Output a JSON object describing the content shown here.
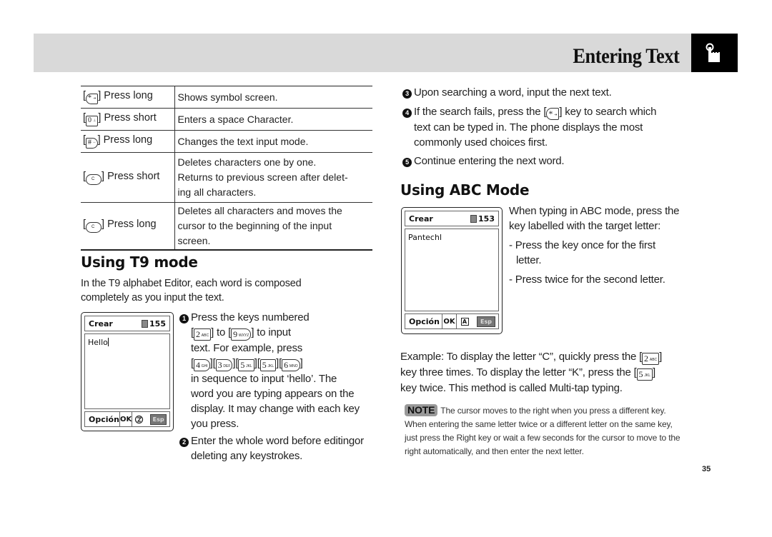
{
  "header": {
    "title": "Entering Text",
    "icon": "hand-pointer-icon"
  },
  "key_table": {
    "rows": [
      {
        "key_icon": "star-key-icon",
        "key_glyph": "*",
        "key_sub": "⇥",
        "action": "Press long",
        "description": [
          "Shows symbol screen."
        ]
      },
      {
        "key_icon": "zero-key-icon",
        "key_glyph": "0",
        "key_sub": "⊥",
        "action": "Press short",
        "description": [
          "Enters a space Character."
        ]
      },
      {
        "key_icon": "hash-key-icon",
        "key_glyph": "#",
        "key_sub": "◦◦",
        "action": "Press long",
        "description": [
          "Changes the text input mode."
        ]
      },
      {
        "key_icon": "clear-key-icon",
        "key_glyph": "C",
        "action": "Press short",
        "description": [
          "Deletes characters one by one.",
          "Returns to previous screen after delet-",
          "ing all characters."
        ]
      },
      {
        "key_icon": "clear-key-icon",
        "key_glyph": "C",
        "action": "Press long",
        "description": [
          "Deletes all characters and moves the",
          "cursor to the beginning of the input",
          "screen."
        ]
      }
    ]
  },
  "t9_section": {
    "title": "Using T9 mode",
    "intro": [
      "In the T9 alphabet Editor, each word is composed",
      "completely as you input the text."
    ],
    "phone": {
      "title": "Crear",
      "counter": "155",
      "text": "Hello",
      "soft_left": "Opción",
      "soft_ok": "OK",
      "mode_icon": "t9-mode-icon",
      "soft_right": "Esp"
    },
    "steps": [
      {
        "number": "1",
        "line1": "Press the keys numbered",
        "key_from": {
          "glyph": "2",
          "sub": "ABC"
        },
        "to_word": "to",
        "key_to": {
          "glyph": "9",
          "sub": "WXYZ"
        },
        "after_keys": "to input",
        "line3": "text. For example, press",
        "sequence": [
          {
            "glyph": "4",
            "sub": "GHI"
          },
          {
            "glyph": "3",
            "sub": "DEF"
          },
          {
            "glyph": "5",
            "sub": "JKL"
          },
          {
            "glyph": "5",
            "sub": "JKL"
          },
          {
            "glyph": "6",
            "sub": "MNO"
          }
        ],
        "lines_after": [
          "in sequence to input ‘hello’. The",
          "word you are typing appears on the",
          "display. It may change with each key",
          "you press."
        ]
      },
      {
        "number": "2",
        "lines": [
          "Enter the whole word before editingor",
          "deleting any keystrokes."
        ]
      },
      {
        "number": "3",
        "lines": [
          "Upon searching a word, input the next text."
        ]
      },
      {
        "number": "4",
        "before_key": "If the search fails, press the [",
        "key": {
          "glyph": "*",
          "sub": "⇥"
        },
        "after_key": "] key to search which",
        "lines": [
          "text can be typed in. The phone displays the most",
          "commonly used choices first."
        ]
      },
      {
        "number": "5",
        "lines": [
          "Continue entering the next word."
        ]
      }
    ]
  },
  "abc_section": {
    "title": "Using ABC Mode",
    "phone": {
      "title": "Crear",
      "counter": "153",
      "text": "Pantechl",
      "soft_left": "Opción",
      "soft_ok": "OK",
      "mode_icon": "abc-mode-icon",
      "mode_glyph": "A",
      "soft_right": "Esp"
    },
    "intro": [
      "When typing in ABC mode, press the",
      "key labelled with the target letter:"
    ],
    "bullets": [
      [
        "- Press the key once for the first",
        "letter."
      ],
      [
        "- Press twice for the second letter."
      ]
    ],
    "example": {
      "line1_before": "Example: To display the letter “C”, quickly press the [",
      "key1": {
        "glyph": "2",
        "sub": "ABC"
      },
      "line2_before": "key three times. To display the letter “K”, press the [",
      "key2": {
        "glyph": "5",
        "sub": "JKL"
      },
      "line3": "key twice. This method is called Multi-tap typing."
    },
    "note": {
      "badge": "NOTE",
      "text": "The cursor moves to the right when you press a different key. When entering the same letter twice or a different letter on the same key, just press the Right key or wait a few seconds for the cursor to move to the right automatically, and then enter the next letter."
    }
  },
  "page_number": "35"
}
